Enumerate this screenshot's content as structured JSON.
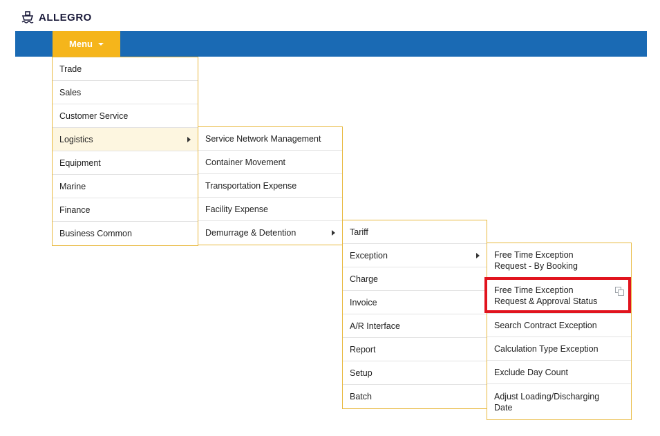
{
  "app": {
    "logo_text": "ALLEGRO"
  },
  "navbar": {
    "menu_label": "Menu"
  },
  "menu_l1": [
    "Trade",
    "Sales",
    "Customer Service",
    "Logistics",
    "Equipment",
    "Marine",
    "Finance",
    "Business Common"
  ],
  "menu_l2": [
    "Service Network Management",
    "Container Movement",
    "Transportation Expense",
    "Facility Expense",
    "Demurrage & Detention"
  ],
  "menu_l3": [
    "Tariff",
    "Exception",
    "Charge",
    "Invoice",
    "A/R Interface",
    "Report",
    "Setup",
    "Batch"
  ],
  "menu_l4": [
    "Free Time Exception Request - By Booking",
    "Free Time Exception Request & Approval Status",
    "Search Contract Exception",
    "Calculation Type Exception",
    "Exclude Day Count",
    "Adjust Loading/Discharging Date"
  ],
  "colors": {
    "navbar": "#1a6ab4",
    "menu_button": "#f5b51b",
    "panel_border": "#e8b83c",
    "highlight": "#e1141e"
  }
}
